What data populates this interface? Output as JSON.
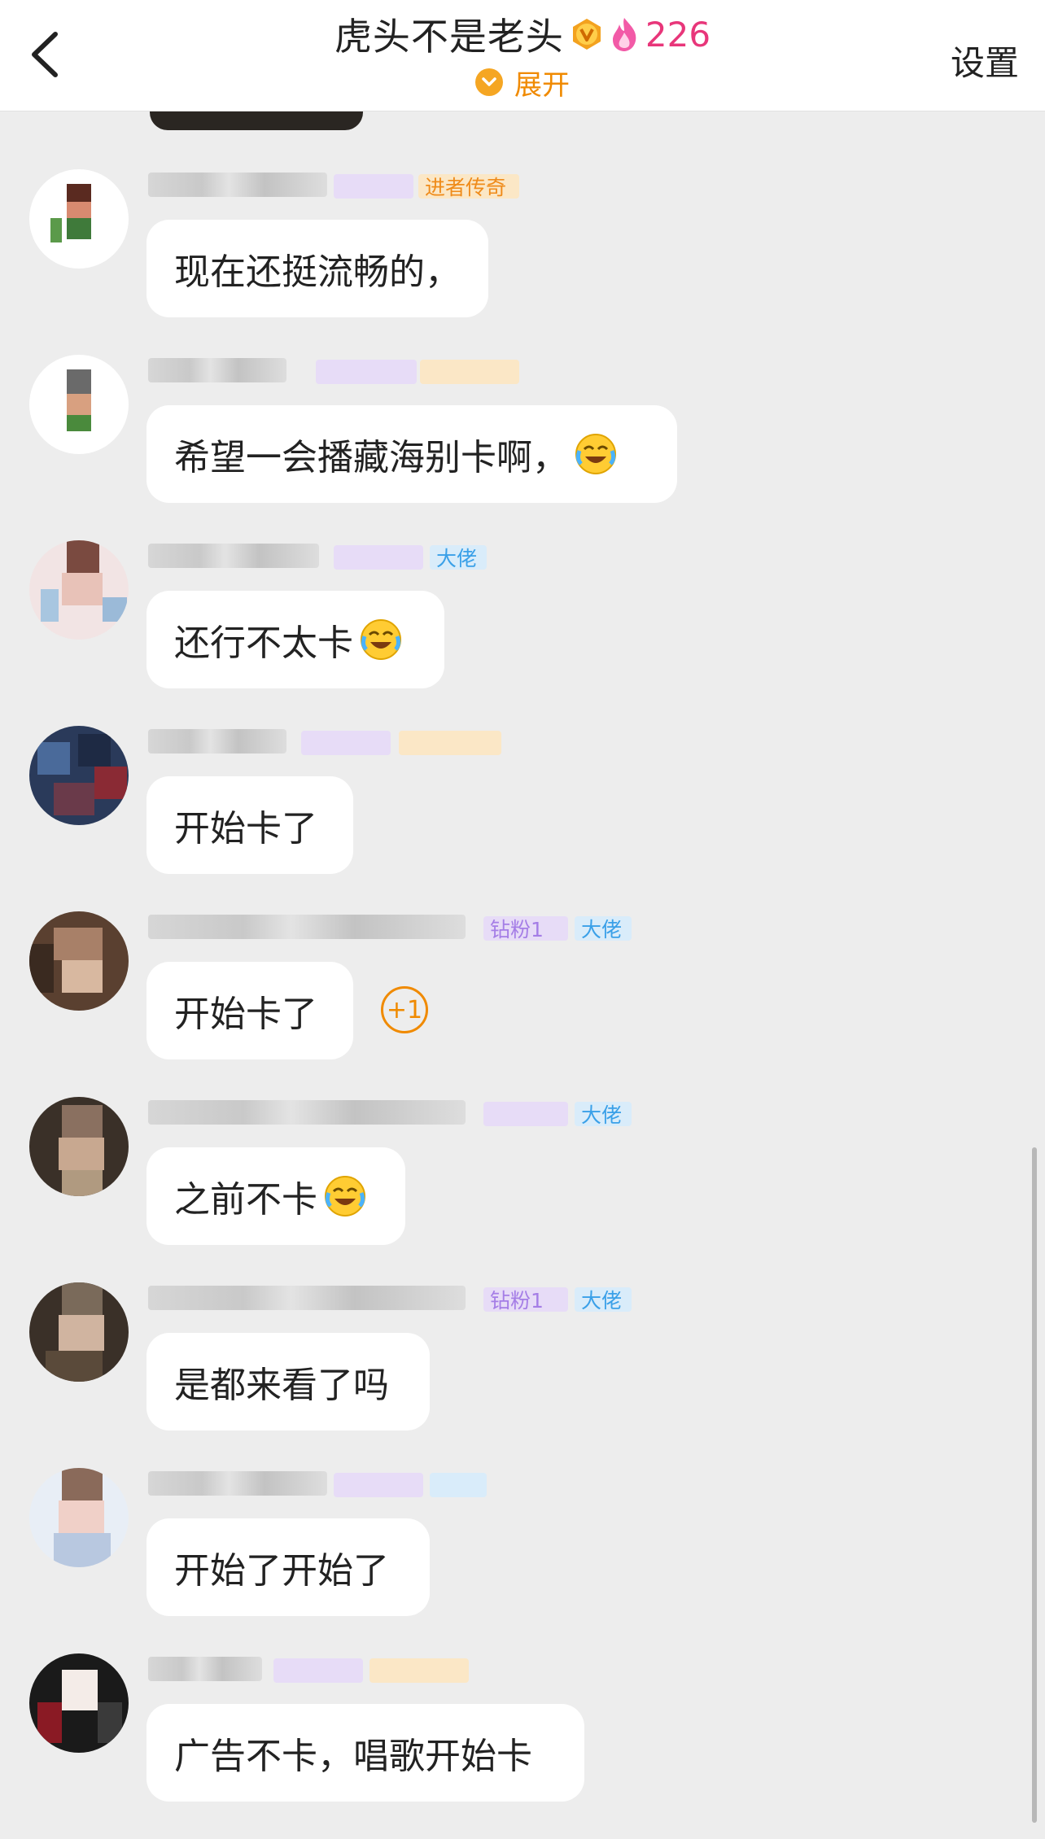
{
  "header": {
    "title": "虎头不是老头",
    "fire_count": "226",
    "expand_label": "展开",
    "settings_label": "设置"
  },
  "messages": [
    {
      "text": "现在还挺流畅的，",
      "badges": [
        {
          "label": "进者传奇",
          "style": "orange"
        }
      ],
      "emoji": false
    },
    {
      "text": "希望一会播藏海别卡啊，",
      "badges": [],
      "emoji": true
    },
    {
      "text": "还行不太卡",
      "badges": [
        {
          "label": "大佬",
          "style": "blue"
        }
      ],
      "emoji": true
    },
    {
      "text": "开始卡了",
      "badges": [],
      "emoji": false
    },
    {
      "text": "开始卡了",
      "badges": [
        {
          "label": "钻粉1",
          "style": "purple"
        },
        {
          "label": "大佬",
          "style": "blue"
        }
      ],
      "emoji": false
    },
    {
      "text": "之前不卡",
      "badges": [
        {
          "label": "大佬",
          "style": "blue"
        }
      ],
      "emoji": true
    },
    {
      "text": "是都来看了吗",
      "badges": [
        {
          "label": "钻粉1",
          "style": "purple"
        },
        {
          "label": "大佬",
          "style": "blue"
        }
      ],
      "emoji": false
    },
    {
      "text": "开始了开始了",
      "badges": [],
      "emoji": false
    },
    {
      "text": "广告不卡，唱歌开始卡",
      "badges": [],
      "emoji": false
    }
  ],
  "reaction": {
    "label": "+1"
  },
  "colors": {
    "accent": "#f08a00",
    "fire": "#e8367a",
    "background": "#ededed"
  }
}
